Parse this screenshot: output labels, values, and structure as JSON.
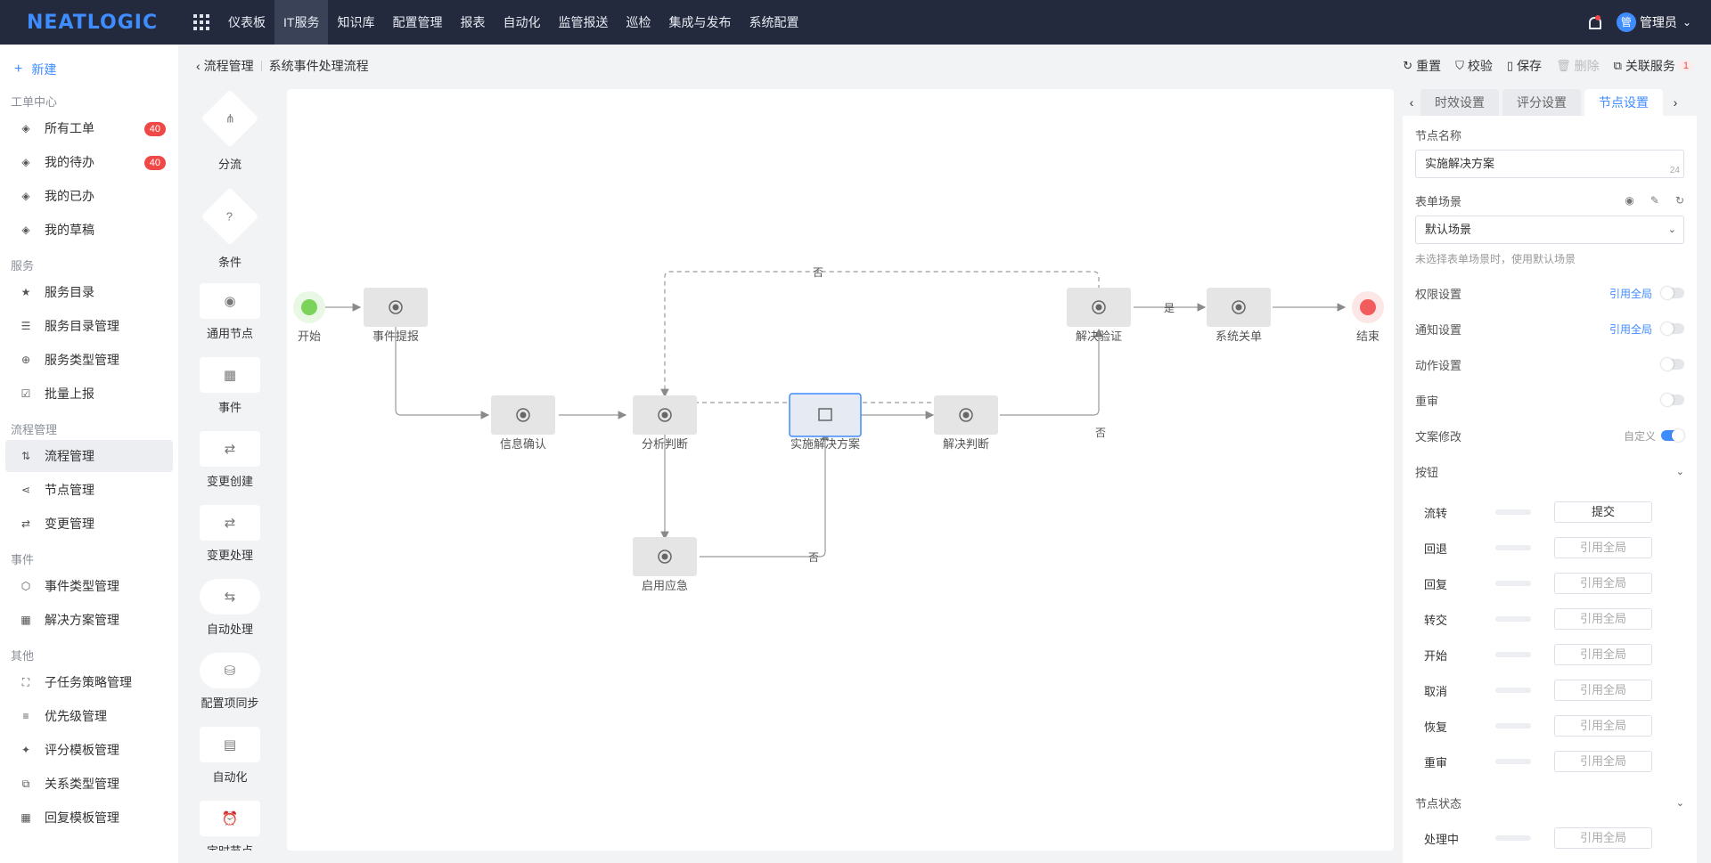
{
  "brand": {
    "logo_text": "NEATLOGIC"
  },
  "nav": {
    "items": [
      "仪表板",
      "IT服务",
      "知识库",
      "配置管理",
      "报表",
      "自动化",
      "监管报送",
      "巡检",
      "集成与发布",
      "系统配置"
    ],
    "active": "IT服务"
  },
  "user": {
    "avatar_text": "管",
    "name": "管理员"
  },
  "sidebar": {
    "new_label": "新建",
    "groups": [
      {
        "title": "工单中心",
        "items": [
          {
            "label": "所有工单",
            "icon": "tag-icon",
            "badge": "40"
          },
          {
            "label": "我的待办",
            "icon": "tag-icon",
            "badge": "40"
          },
          {
            "label": "我的已办",
            "icon": "tag-icon"
          },
          {
            "label": "我的草稿",
            "icon": "tag-icon"
          }
        ]
      },
      {
        "title": "服务",
        "items": [
          {
            "label": "服务目录",
            "icon": "star-icon"
          },
          {
            "label": "服务目录管理",
            "icon": "list-icon"
          },
          {
            "label": "服务类型管理",
            "icon": "plus-circle-icon"
          },
          {
            "label": "批量上报",
            "icon": "checklist-icon"
          }
        ]
      },
      {
        "title": "流程管理",
        "items": [
          {
            "label": "流程管理",
            "icon": "flow-icon",
            "active": true
          },
          {
            "label": "节点管理",
            "icon": "share-icon"
          },
          {
            "label": "变更管理",
            "icon": "swap-icon"
          }
        ]
      },
      {
        "title": "事件",
        "items": [
          {
            "label": "事件类型管理",
            "icon": "hexagon-icon"
          },
          {
            "label": "解决方案管理",
            "icon": "calendar-icon"
          }
        ]
      },
      {
        "title": "其他",
        "items": [
          {
            "label": "子任务策略管理",
            "icon": "task-icon"
          },
          {
            "label": "优先级管理",
            "icon": "priority-icon"
          },
          {
            "label": "评分模板管理",
            "icon": "rating-icon"
          },
          {
            "label": "关系类型管理",
            "icon": "relation-icon"
          },
          {
            "label": "回复模板管理",
            "icon": "grid-icon"
          }
        ]
      }
    ]
  },
  "breadcrumb": {
    "parent": "流程管理",
    "current": "系统事件处理流程"
  },
  "actions": {
    "reset": "重置",
    "validate": "校验",
    "save": "保存",
    "delete": "删除",
    "related": "关联服务",
    "related_count": "1"
  },
  "palette": [
    {
      "label": "分流",
      "shape": "diamond",
      "icon": "⋔"
    },
    {
      "label": "条件",
      "shape": "diamond",
      "icon": "?"
    },
    {
      "label": "通用节点",
      "shape": "rect",
      "icon": "◉"
    },
    {
      "label": "事件",
      "shape": "rect",
      "icon": "▦"
    },
    {
      "label": "变更创建",
      "shape": "rect",
      "icon": "⇄"
    },
    {
      "label": "变更处理",
      "shape": "rect",
      "icon": "⇄"
    },
    {
      "label": "自动处理",
      "shape": "pill",
      "icon": "⇆"
    },
    {
      "label": "配置项同步",
      "shape": "pill",
      "icon": "⛁"
    },
    {
      "label": "自动化",
      "shape": "rect",
      "icon": "▤"
    },
    {
      "label": "定时节点",
      "shape": "rect",
      "icon": "⏰"
    }
  ],
  "flow": {
    "nodes": [
      {
        "id": "start",
        "label": "开始",
        "type": "start"
      },
      {
        "id": "n1",
        "label": "事件提报",
        "type": "task"
      },
      {
        "id": "n2",
        "label": "信息确认",
        "type": "task"
      },
      {
        "id": "n3",
        "label": "分析判断",
        "type": "task"
      },
      {
        "id": "n4",
        "label": "实施解决方案",
        "type": "event",
        "selected": true
      },
      {
        "id": "n5",
        "label": "解决判断",
        "type": "task"
      },
      {
        "id": "n6",
        "label": "启用应急",
        "type": "task"
      },
      {
        "id": "n7",
        "label": "解决验证",
        "type": "task"
      },
      {
        "id": "n8",
        "label": "系统关单",
        "type": "task"
      },
      {
        "id": "end",
        "label": "结束",
        "type": "end"
      }
    ],
    "edge_labels": {
      "no": "否",
      "yes": "是"
    }
  },
  "panel": {
    "tabs": [
      "时效设置",
      "评分设置",
      "节点设置"
    ],
    "active_tab": "节点设置",
    "node_name_label": "节点名称",
    "node_name_value": "实施解决方案",
    "node_name_count": "24",
    "form_scene_label": "表单场景",
    "form_scene_value": "默认场景",
    "form_scene_hint": "未选择表单场景时，使用默认场景",
    "settings": [
      {
        "label": "权限设置",
        "link": "引用全局",
        "on": false
      },
      {
        "label": "通知设置",
        "link": "引用全局",
        "on": false
      },
      {
        "label": "动作设置",
        "on": false
      },
      {
        "label": "重审",
        "on": false
      },
      {
        "label": "文案修改",
        "custom": "自定义",
        "on": true
      }
    ],
    "buttons_label": "按钮",
    "buttons": [
      {
        "name": "流转",
        "value": "提交",
        "filled": true
      },
      {
        "name": "回退",
        "value": "引用全局"
      },
      {
        "name": "回复",
        "value": "引用全局"
      },
      {
        "name": "转交",
        "value": "引用全局"
      },
      {
        "name": "开始",
        "value": "引用全局"
      },
      {
        "name": "取消",
        "value": "引用全局"
      },
      {
        "name": "恢复",
        "value": "引用全局"
      },
      {
        "name": "重审",
        "value": "引用全局"
      }
    ],
    "node_status_label": "节点状态",
    "statuses": [
      {
        "name": "处理中",
        "value": "引用全局"
      }
    ]
  }
}
